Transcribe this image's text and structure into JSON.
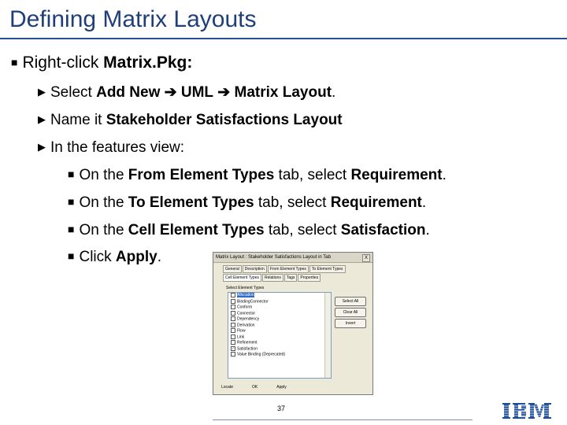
{
  "title": "Defining Matrix Layouts",
  "step": {
    "prefix": "Right-click ",
    "target": "Matrix.Pkg:"
  },
  "sub": [
    {
      "t1": "Select ",
      "b1": "Add New",
      "b2": "UML",
      "b3": "Matrix Layout",
      "t2": "."
    },
    {
      "t1": "Name it ",
      "b1": "Stakeholder Satisfactions Layout"
    },
    {
      "t1": "In the features view:"
    }
  ],
  "features": [
    {
      "t1": "On the ",
      "b1": "From Element Types",
      "t2": " tab, select ",
      "b2": "Requirement",
      "t3": "."
    },
    {
      "t1": "On the ",
      "b1": "To Element Types",
      "t2": " tab, select ",
      "b2": "Requirement",
      "t3": "."
    },
    {
      "t1": "On the ",
      "b1": "Cell Element Types",
      "t2": " tab, select ",
      "b2": "Satisfaction",
      "t3": "."
    },
    {
      "t1": "Click ",
      "b1": "Apply",
      "t3": "."
    }
  ],
  "dialog": {
    "title": "Matrix Layout : Stakeholder Satisfactions Layout in Tab",
    "close": "X",
    "tabs": [
      "General",
      "Description",
      "From Element Types",
      "To Element Types",
      "Cell Element Types",
      "Relations",
      "Tags",
      "Properties"
    ],
    "group_label": "Select Element Types",
    "items": [
      {
        "label": "Allocation",
        "checked": false
      },
      {
        "label": "BindingConnector",
        "checked": false
      },
      {
        "label": "Conform",
        "checked": false
      },
      {
        "label": "Connector",
        "checked": false
      },
      {
        "label": "Dependency",
        "checked": false
      },
      {
        "label": "Derivation",
        "checked": false
      },
      {
        "label": "Flow",
        "checked": false
      },
      {
        "label": "Link",
        "checked": false
      },
      {
        "label": "Refinement",
        "checked": false
      },
      {
        "label": "Satisfaction",
        "checked": true
      },
      {
        "label": "Value Binding (Deprecated)",
        "checked": false
      }
    ],
    "buttons": [
      "Select All",
      "Clear All",
      "Invert"
    ],
    "footer": [
      "Locate",
      "OK",
      "Apply"
    ]
  },
  "page_number": "37",
  "logo": "IBM"
}
